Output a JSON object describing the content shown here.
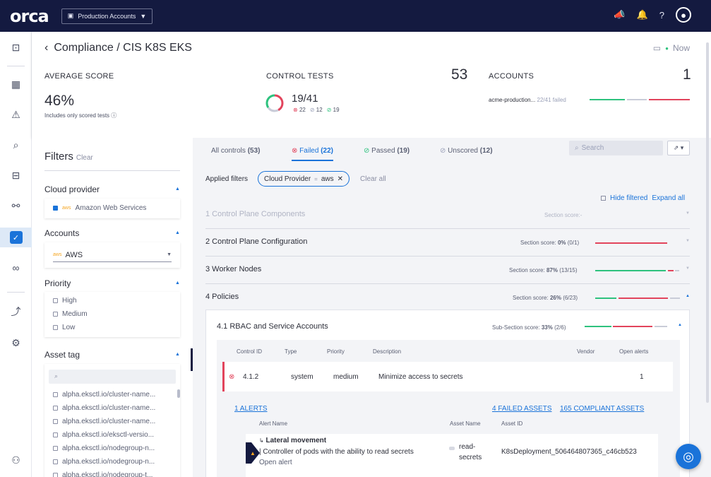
{
  "topbar": {
    "logo": "orca",
    "account_select": "Production Accounts"
  },
  "header": {
    "breadcrumb": "Compliance / CIS K8S EKS",
    "now": "Now",
    "average_score": {
      "label": "AVERAGE SCORE",
      "value": "46%",
      "note": "Includes only scored tests"
    },
    "control_tests": {
      "label": "CONTROL TESTS",
      "total": "53",
      "ratio": "19/41",
      "failed": "22",
      "unscored": "12",
      "passed": "19"
    },
    "accounts": {
      "label": "ACCOUNTS",
      "count": "1",
      "rows": [
        {
          "name": "acme-production...",
          "status": "22/41 failed"
        }
      ]
    }
  },
  "filters": {
    "title": "Filters",
    "clear": "Clear",
    "cloud_provider": {
      "label": "Cloud provider",
      "items": [
        {
          "label": "Amazon Web Services",
          "icon_text": "aws",
          "checked": true
        }
      ]
    },
    "accounts": {
      "label": "Accounts",
      "icon_text": "aws",
      "selected": "AWS"
    },
    "priority": {
      "label": "Priority",
      "items": [
        "High",
        "Medium",
        "Low"
      ]
    },
    "asset_tag": {
      "label": "Asset tag",
      "items": [
        "alpha.eksctl.io/cluster-name...",
        "alpha.eksctl.io/cluster-name...",
        "alpha.eksctl.io/cluster-name...",
        "alpha.eksctl.io/eksctl-versio...",
        "alpha.eksctl.io/nodegroup-n...",
        "alpha.eksctl.io/nodegroup-n...",
        "alpha.eksctl.io/nodegroup-t..."
      ]
    }
  },
  "tabs": [
    {
      "label": "All controls",
      "count": "(53)"
    },
    {
      "label": "Failed",
      "count": "(22)"
    },
    {
      "label": "Passed",
      "count": "(19)"
    },
    {
      "label": "Unscored",
      "count": "(12)"
    }
  ],
  "search": {
    "placeholder": "Search"
  },
  "applied": {
    "label": "Applied filters",
    "chip_key": "Cloud Provider",
    "chip_op": "=",
    "chip_value": "aws",
    "clear_all": "Clear all"
  },
  "hide_filtered": "Hide filtered",
  "expand_all": "Expand all",
  "sections": [
    {
      "name": "1 Control Plane Components",
      "score_label": "Section score:",
      "score": "-",
      "detail": ""
    },
    {
      "name": "2 Control Plane Configuration",
      "score_label": "Section score:",
      "score": "0%",
      "detail": "(0/1)"
    },
    {
      "name": "3 Worker Nodes",
      "score_label": "Section score:",
      "score": "87%",
      "detail": "(13/15)"
    },
    {
      "name": "4 Policies",
      "score_label": "Section score:",
      "score": "26%",
      "detail": "(6/23)"
    }
  ],
  "subsection": {
    "name": "4.1 RBAC and Service Accounts",
    "score_label": "Sub-Section score:",
    "score": "33%",
    "detail": "(2/6)",
    "headers": [
      "Control ID",
      "Type",
      "Priority",
      "Description",
      "Vendor",
      "Open alerts"
    ],
    "row": {
      "id": "4.1.2",
      "type": "system",
      "priority": "medium",
      "description": "Minimize access to secrets",
      "alerts": "1"
    },
    "links": {
      "alerts": "1 ALERTS",
      "failed": "4 FAILED ASSETS",
      "compliant": "165 COMPLIANT ASSETS"
    },
    "alert_headers": [
      "Alert Name",
      "Asset Name",
      "Asset ID"
    ],
    "alert": {
      "title": "Lateral movement",
      "desc": "Controller of pods with the ability to read secrets",
      "status": "Open alert",
      "asset_name": "read-secrets",
      "asset_id": "K8sDeployment_506464807365_c46cb523"
    }
  },
  "colors": {
    "accent": "#1a73d9",
    "fail": "#e2445c",
    "pass": "#2ec27e",
    "nav": "#141a40"
  }
}
